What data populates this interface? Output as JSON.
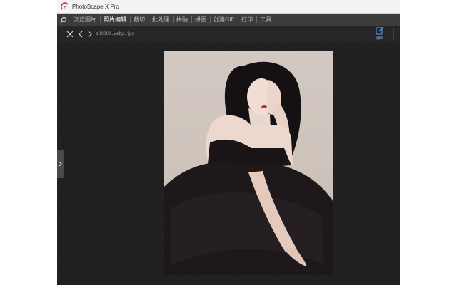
{
  "window": {
    "title": "PhotoScape X Pro"
  },
  "menu": {
    "tabs": [
      {
        "label": "浏览图片"
      },
      {
        "label": "照片编辑",
        "active": true
      },
      {
        "label": "裁切"
      },
      {
        "label": "批处理"
      },
      {
        "label": "拼贴"
      },
      {
        "label": "拼图"
      },
      {
        "label": "创建GIF"
      },
      {
        "label": "打印"
      },
      {
        "label": "工具"
      }
    ]
  },
  "toolbar": {
    "filename": "s00000.webp.jpg",
    "edit_label": "编辑"
  },
  "colors": {
    "logo_red": "#e03a2f",
    "logo_grey": "#888888",
    "edit_icon": "#4aa3ff"
  },
  "icons": {
    "search": "search-icon",
    "close": "close-icon",
    "prev": "chevron-left-icon",
    "next": "chevron-right-icon",
    "edit": "edit-icon",
    "side_toggle": "chevron-right-icon"
  }
}
